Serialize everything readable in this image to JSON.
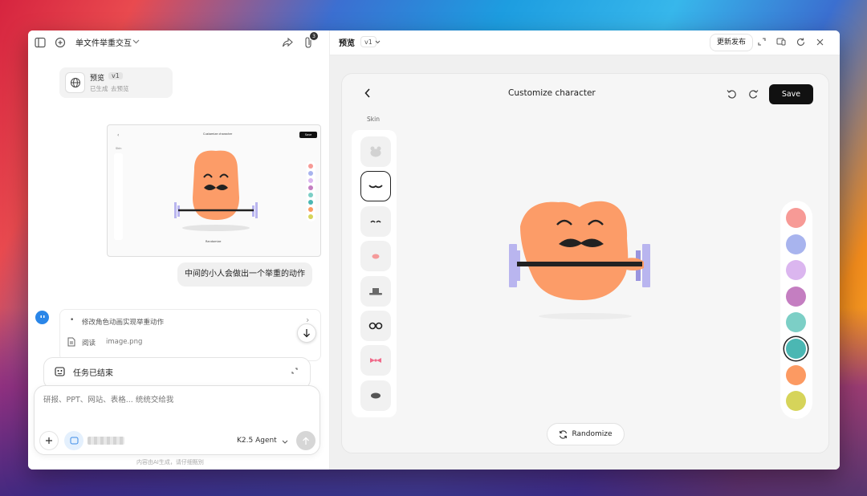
{
  "left": {
    "header_title": "单文件举重交互",
    "badge_count": "3",
    "preview_card": {
      "title": "预览",
      "version": "v1",
      "sub1": "已生成",
      "sub2": "去预览"
    },
    "thumb": {
      "title": "Customize character",
      "save": "Save",
      "skin": "Skin",
      "randomize": "Randomize"
    },
    "user_message": "中间的小人会做出一个举重的动作",
    "steps": [
      {
        "label": "修改角色动画实现举重动作"
      },
      {
        "label": "阅读",
        "file": "image.png"
      }
    ],
    "task_done": "任务已结束",
    "input_placeholder": "研报、PPT、网站、表格... 统统交给我",
    "model": "K2.5 Agent",
    "disclaimer": "内容由AI生成，请仔细甄别"
  },
  "right": {
    "title": "预览",
    "version": "v1",
    "publish": "更新发布",
    "card": {
      "title": "Customize character",
      "save": "Save",
      "skin_label": "Skin",
      "randomize": "Randomize"
    },
    "colors": [
      "#f79a96",
      "#a8b4ee",
      "#dbb6ef",
      "#c47ec1",
      "#7ccfc6",
      "#4bb7b3",
      "#fc9a62",
      "#d6d45a"
    ],
    "selected_color": "#4bb7b3",
    "character_color": "#fc9c68",
    "dumbbell_color": "#b9b5ef"
  }
}
